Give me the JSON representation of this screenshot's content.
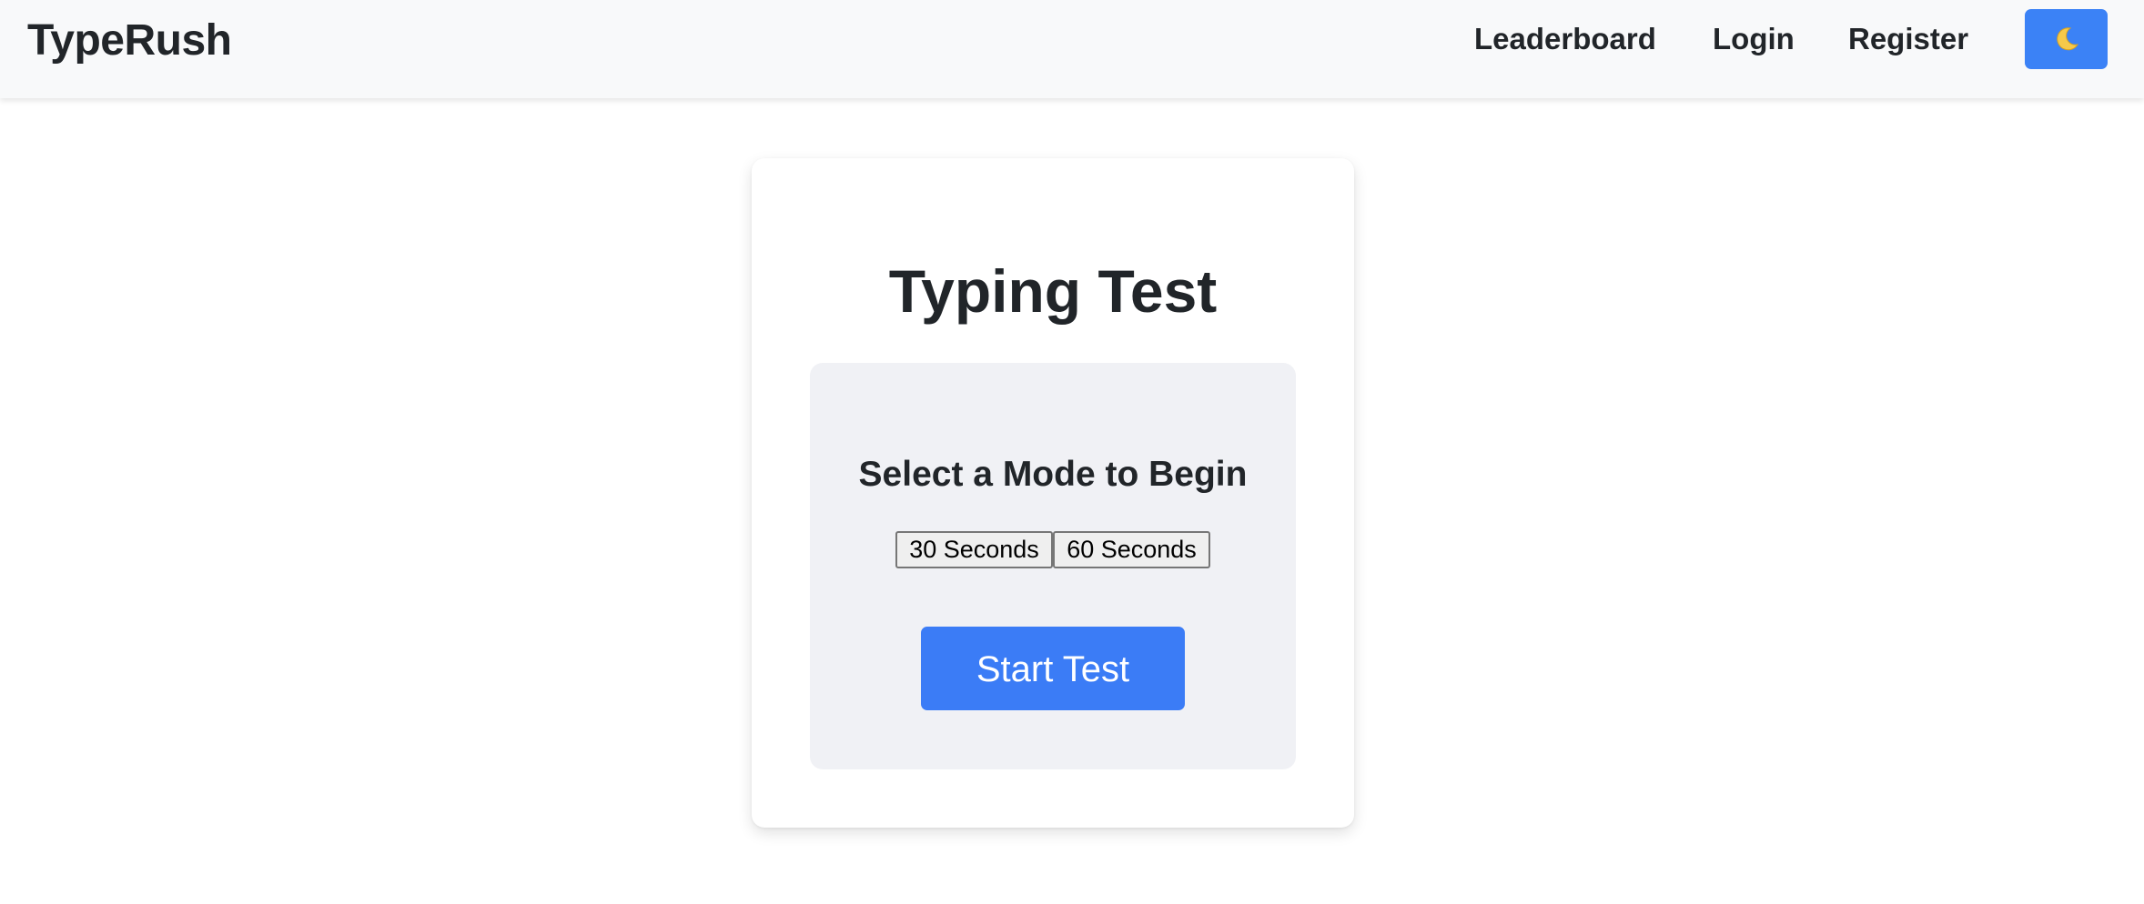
{
  "header": {
    "brand": "TypeRush",
    "nav": {
      "leaderboard": "Leaderboard",
      "login": "Login",
      "register": "Register"
    },
    "theme_toggle_icon": "moon-icon"
  },
  "main": {
    "title": "Typing Test",
    "panel": {
      "heading": "Select a Mode to Begin",
      "modes": [
        "30 Seconds",
        "60 Seconds"
      ],
      "start_label": "Start Test"
    }
  },
  "colors": {
    "accent": "#3b82f6",
    "navbar_bg": "#f8f9fa",
    "panel_bg": "#f0f1f5",
    "text": "#212529"
  }
}
